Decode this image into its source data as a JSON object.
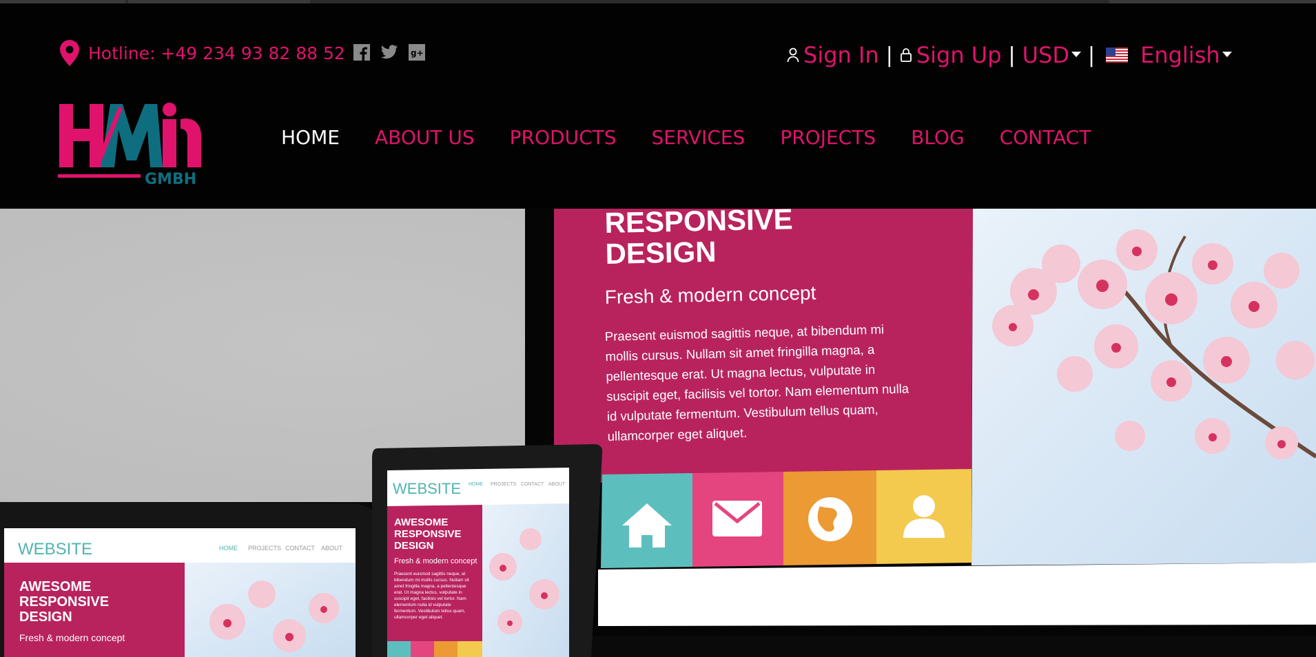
{
  "header": {
    "hotline": "Hotline: +49 234 93 82 88 52",
    "social_icons": [
      "facebook-icon",
      "twitter-icon",
      "google-plus-icon"
    ],
    "account": {
      "sign_in": "Sign In",
      "sign_up": "Sign Up",
      "separator": "|",
      "currency": "USD",
      "language": "English"
    },
    "logo": {
      "main": "HMi",
      "sub": "GMBH"
    },
    "nav": [
      {
        "label": "HOME",
        "active": true
      },
      {
        "label": "ABOUT US",
        "active": false
      },
      {
        "label": "PRODUCTS",
        "active": false
      },
      {
        "label": "SERVICES",
        "active": false
      },
      {
        "label": "PROJECTS",
        "active": false
      },
      {
        "label": "BLOG",
        "active": false
      },
      {
        "label": "CONTACT",
        "active": false
      }
    ]
  },
  "hero": {
    "monitor": {
      "heading_line1": "RESPONSIVE",
      "heading_line2": "DESIGN",
      "subheading": "Fresh & modern concept",
      "body_lines": [
        "Praesent euismod sagittis neque, at bibendum mi",
        "mollis cursus. Nullam sit amet fringilla magna, a",
        "pellentesque erat. Ut magna lectus, vulputate in",
        "suscipit eget, facilisis vel tortor. Nam elementum nulla",
        "id vulputate fermentum. Vestibulum tellus quam,",
        "ullamcorper eget aliquet."
      ]
    },
    "tablet": {
      "brand": "WEBSITE",
      "nav": [
        "HOME",
        "PROJECTS",
        "CONTACT",
        "ABOUT"
      ],
      "heading_lines": [
        "AWESOME",
        "RESPONSIVE",
        "DESIGN"
      ],
      "subheading": "Fresh & modern concept",
      "body_lines": [
        "Praesent euismod sagittis neque, at",
        "bibendum mi mollis cursus. Nullam sit",
        "amet fringilla magna, a pellentesque",
        "erat. Ut magna lectus, vulputate in",
        "suscipit eget, facilisis vel tortor. Nam",
        "elementum nulla id vulputate",
        "fermentum. Vestibulum tellus quam,",
        "ullamcorper eget aliquet."
      ]
    },
    "laptop": {
      "brand": "WEBSITE",
      "nav": [
        "HOME",
        "PROJECTS",
        "CONTACT",
        "ABOUT"
      ],
      "heading_lines": [
        "AWESOME",
        "RESPONSIVE",
        "DESIGN"
      ],
      "subheading": "Fresh & modern concept"
    },
    "colors": {
      "magenta": "#b8235e",
      "teal": "#5dbfbd",
      "pink": "#e5457f",
      "orange": "#eb9a34",
      "yellow": "#f3c94e"
    }
  },
  "colors": {
    "accent": "#e0136c",
    "header_bg": "#020202",
    "logo_teal": "#0e6e80"
  }
}
